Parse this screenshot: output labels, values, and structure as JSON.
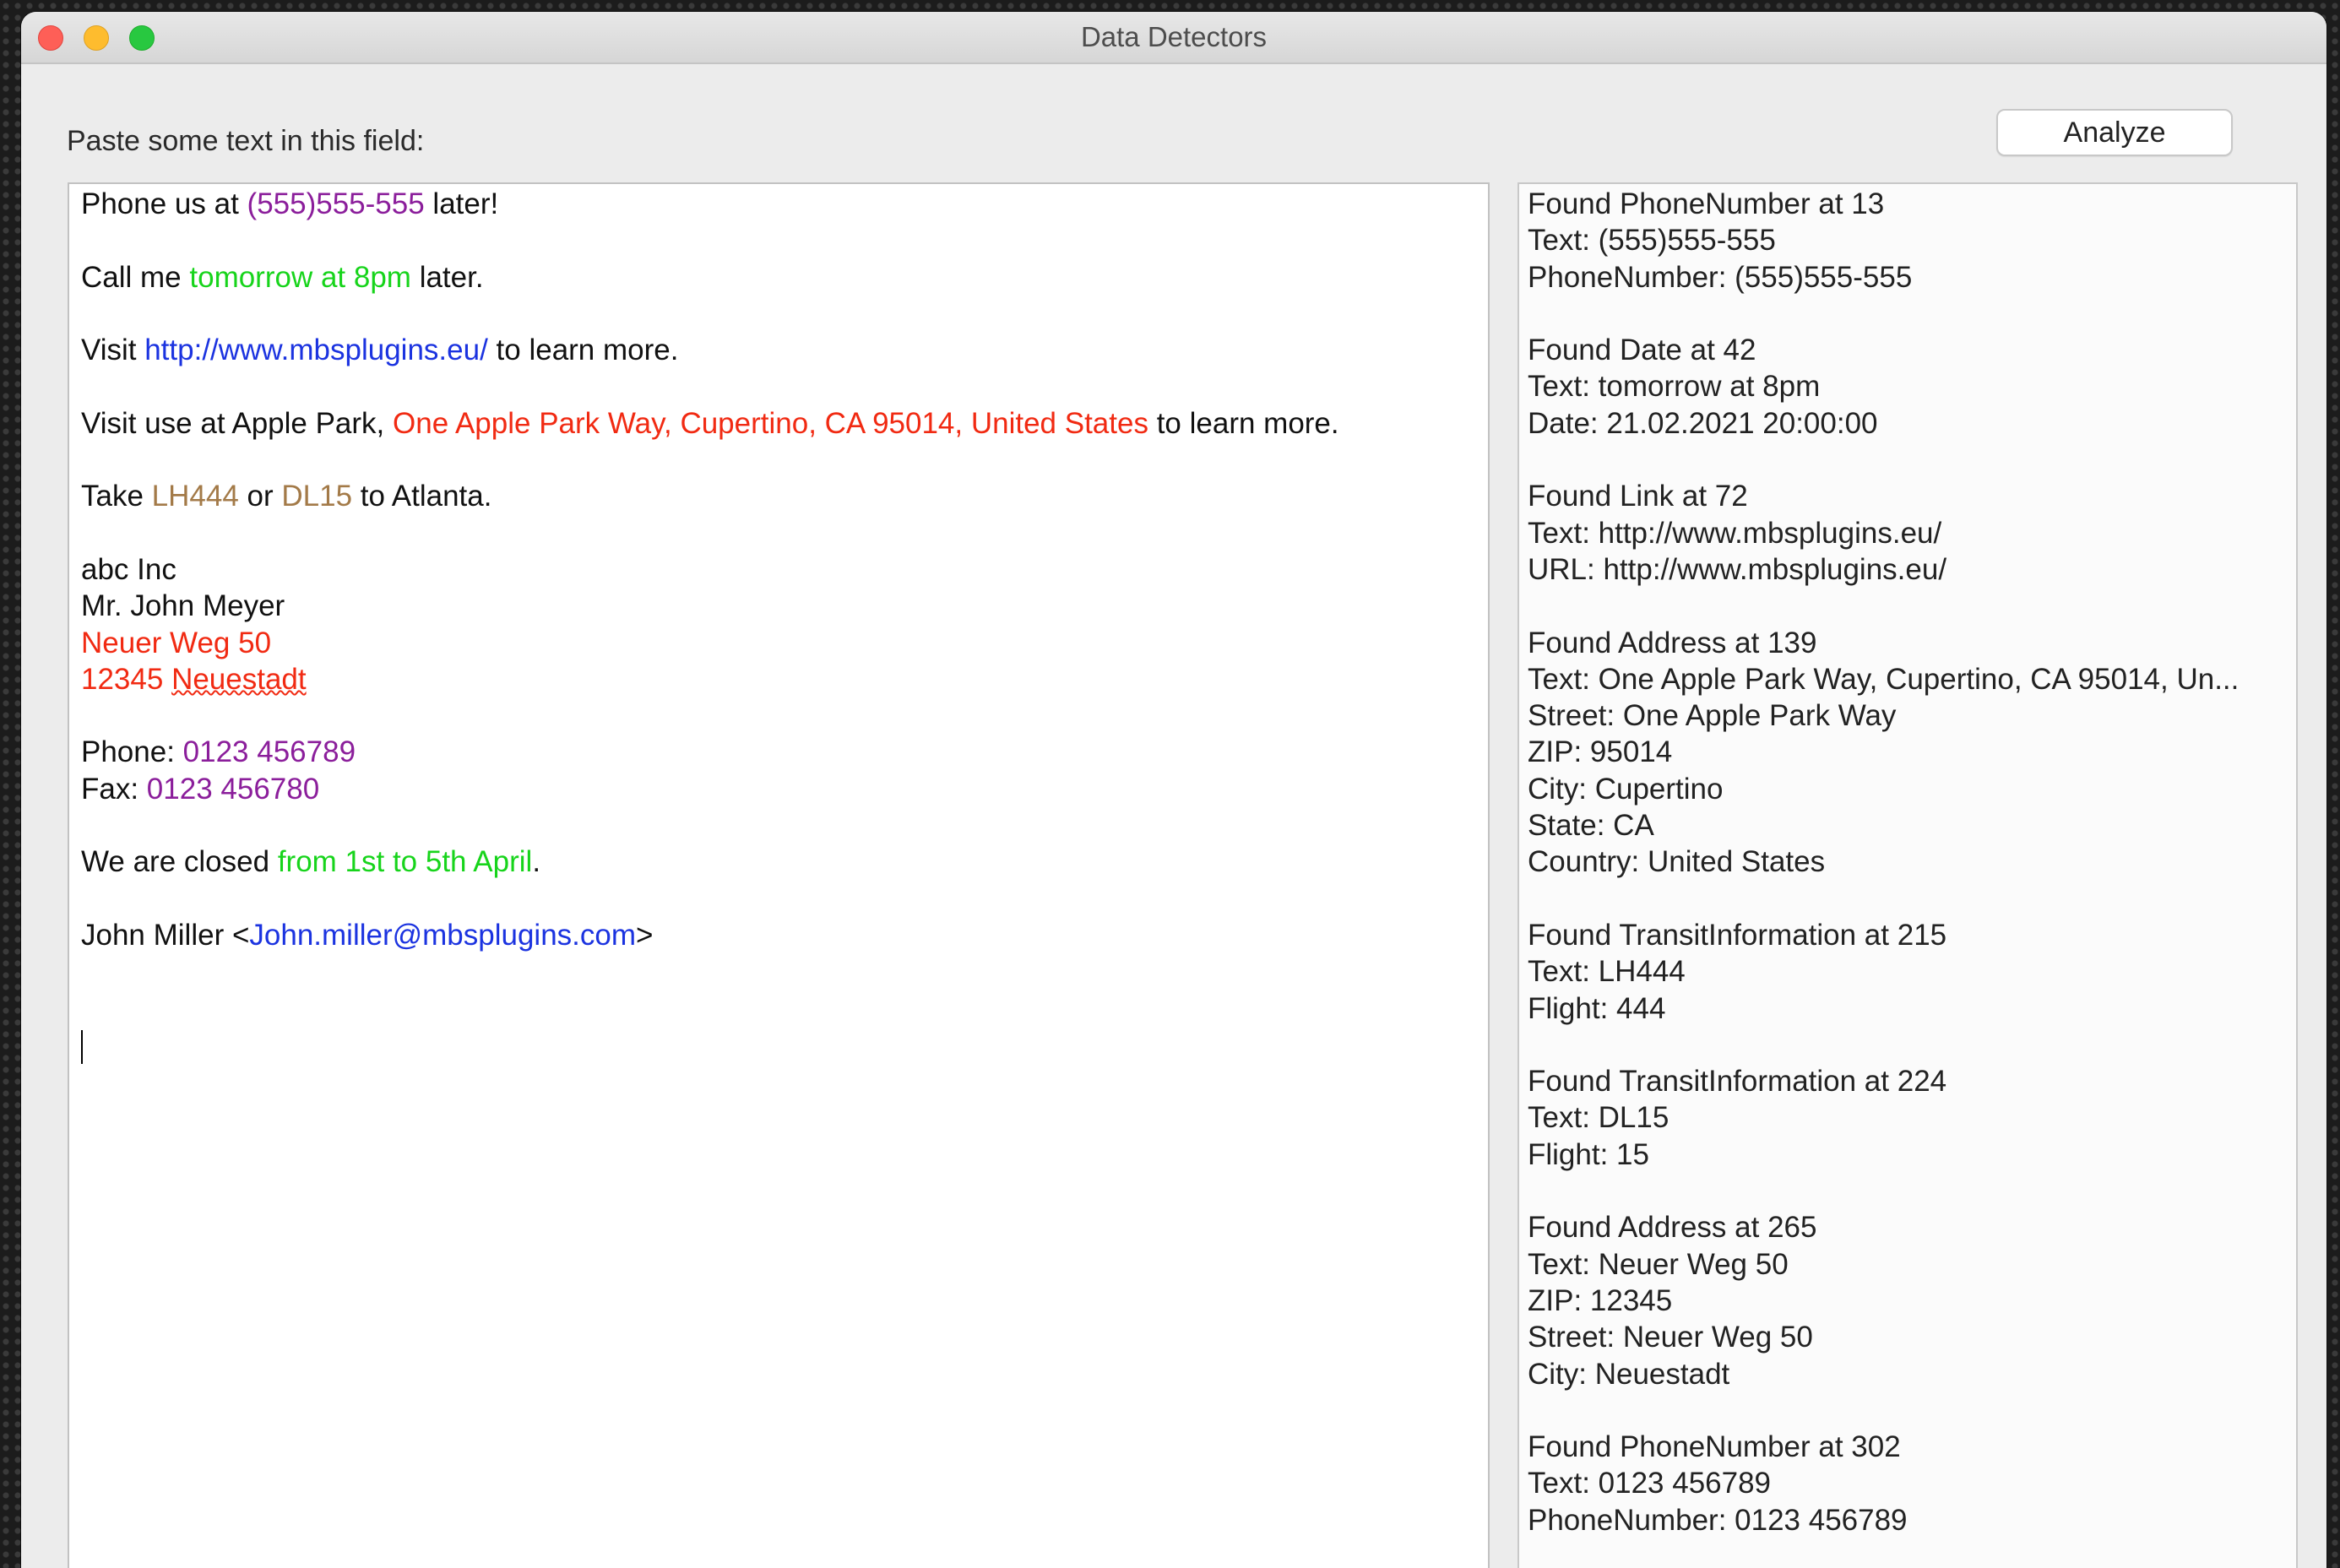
{
  "window": {
    "title": "Data Detectors"
  },
  "colors": {
    "phone": "#8b1e9b",
    "date": "#17d41b",
    "link": "#1b33e0",
    "address": "#f12a12",
    "transit": "#a37a48"
  },
  "form": {
    "prompt_label": "Paste some text in this field:",
    "analyze_label": "Analyze"
  },
  "input": {
    "line1": {
      "before": "Phone us at ",
      "phone": "(555)555-555",
      "after": " later!"
    },
    "line2": {
      "before": "Call me ",
      "date": "tomorrow at 8pm",
      "after": " later."
    },
    "line3": {
      "before": "Visit ",
      "link": "http://www.mbsplugins.eu/",
      "after": " to learn more."
    },
    "line4": {
      "before": "Visit use at Apple Park, ",
      "address": "One Apple Park Way, Cupertino, CA 95014, United States",
      "after": " to learn more."
    },
    "line5": {
      "before": "Take ",
      "transit1": "LH444",
      "mid": " or ",
      "transit2": "DL15",
      "after": " to Atlanta."
    },
    "company": "abc Inc",
    "person": "Mr. John Meyer",
    "street": "Neuer Weg 50",
    "zip": "12345",
    "city": "Neuestadt",
    "phone_label": "Phone: ",
    "phone_value": "0123 456789",
    "fax_label": "Fax: ",
    "fax_value": "0123 456780",
    "closed": {
      "before": "We are closed ",
      "date": "from 1st to 5th April",
      "after": "."
    },
    "email": {
      "before": "John Miller <",
      "link": "John.miller@mbsplugins.com",
      "after": ">"
    }
  },
  "results": [
    [
      "Found PhoneNumber at 13",
      "Text: (555)555-555",
      "PhoneNumber: (555)555-555"
    ],
    [
      "Found Date at 42",
      "Text: tomorrow at 8pm",
      "Date: 21.02.2021 20:00:00"
    ],
    [
      "Found Link at 72",
      "Text: http://www.mbsplugins.eu/",
      "URL: http://www.mbsplugins.eu/"
    ],
    [
      "Found Address at 139",
      "Text: One Apple Park Way, Cupertino, CA 95014, Un...",
      "Street: One Apple Park Way",
      "ZIP: 95014",
      "City: Cupertino",
      "State: CA",
      "Country: United States"
    ],
    [
      "Found TransitInformation at 215",
      "Text: LH444",
      "Flight: 444"
    ],
    [
      "Found TransitInformation at 224",
      "Text: DL15",
      "Flight: 15"
    ],
    [
      "Found Address at 265",
      "Text: Neuer Weg 50",
      "ZIP: 12345",
      "Street: Neuer Weg 50",
      "City: Neuestadt"
    ],
    [
      "Found PhoneNumber at 302",
      "Text: 0123 456789",
      "PhoneNumber: 0123 456789"
    ]
  ]
}
